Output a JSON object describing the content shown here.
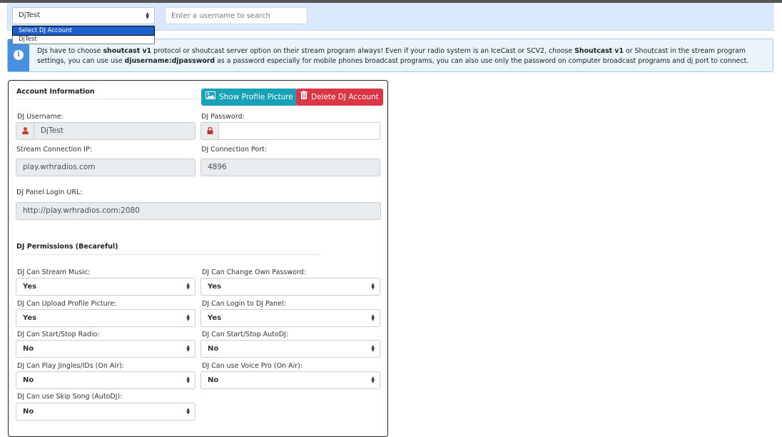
{
  "account_select": {
    "value": "DjTest",
    "options": [
      {
        "label": "Select DJ Account"
      },
      {
        "label": "DjTest"
      }
    ]
  },
  "search": {
    "placeholder": "Enter a username to search"
  },
  "notice": {
    "icon": "info-icon",
    "parts": [
      {
        "text": "DJs have to choose ",
        "bold": false
      },
      {
        "text": "shoutcast v1",
        "bold": true
      },
      {
        "text": " protocol or shoutcast server option on their stream program always! Even if your radio system is an IceCast or SCV2, choose ",
        "bold": false
      },
      {
        "text": "Shoutcast v1",
        "bold": true
      },
      {
        "text": " or Shoutcast in the stream program settings, you can use use ",
        "bold": false
      },
      {
        "text": "djusername:djpassword",
        "bold": true
      },
      {
        "text": " as a password especially for mobile phones broadcast programs, you can also use only the password on computer broadcast programs and dj port to connect.",
        "bold": false
      }
    ]
  },
  "account_info": {
    "title": "Account Information",
    "show_picture_button": "Show Profile Picture",
    "delete_button": "Delete DJ Account",
    "username_label": "DJ Username:",
    "username_value": "DjTest",
    "password_label": "DJ Password:",
    "password_value": "",
    "ip_label": "Stream Connection IP:",
    "ip_value": "play.wrhradios.com",
    "port_label": "DJ Connection Port:",
    "port_value": "4896",
    "login_url_label": "DJ Panel Login URL:",
    "login_url_value": "http://play.wrhradios.com:2080"
  },
  "permissions": {
    "title": "DJ Permissions (Becareful)",
    "items": [
      {
        "label": "DJ Can Stream Music:",
        "value": "Yes"
      },
      {
        "label": "DJ Can Change Own Password:",
        "value": "Yes"
      },
      {
        "label": "DJ Can Upload Profile Picture:",
        "value": "Yes"
      },
      {
        "label": "DJ Can Login to DJ Panel:",
        "value": "Yes"
      },
      {
        "label": "DJ Can Start/Stop Radio:",
        "value": "No"
      },
      {
        "label": "DJ Can Start/Stop AutoDJ:",
        "value": "No"
      },
      {
        "label": "DJ Can Play Jingles/IDs (On Air):",
        "value": "No"
      },
      {
        "label": "DJ Can use Voice Pro (On Air):",
        "value": "No"
      },
      {
        "label": "DJ Can use Skip Song (AutoDJ):",
        "value": "No"
      }
    ]
  },
  "colors": {
    "info": "#17a2b8",
    "danger": "#dc3545",
    "alert_icon_bg": "#4a90e2",
    "top_panel_bg": "#d9e8fb",
    "user_icon": "#c0392b"
  }
}
